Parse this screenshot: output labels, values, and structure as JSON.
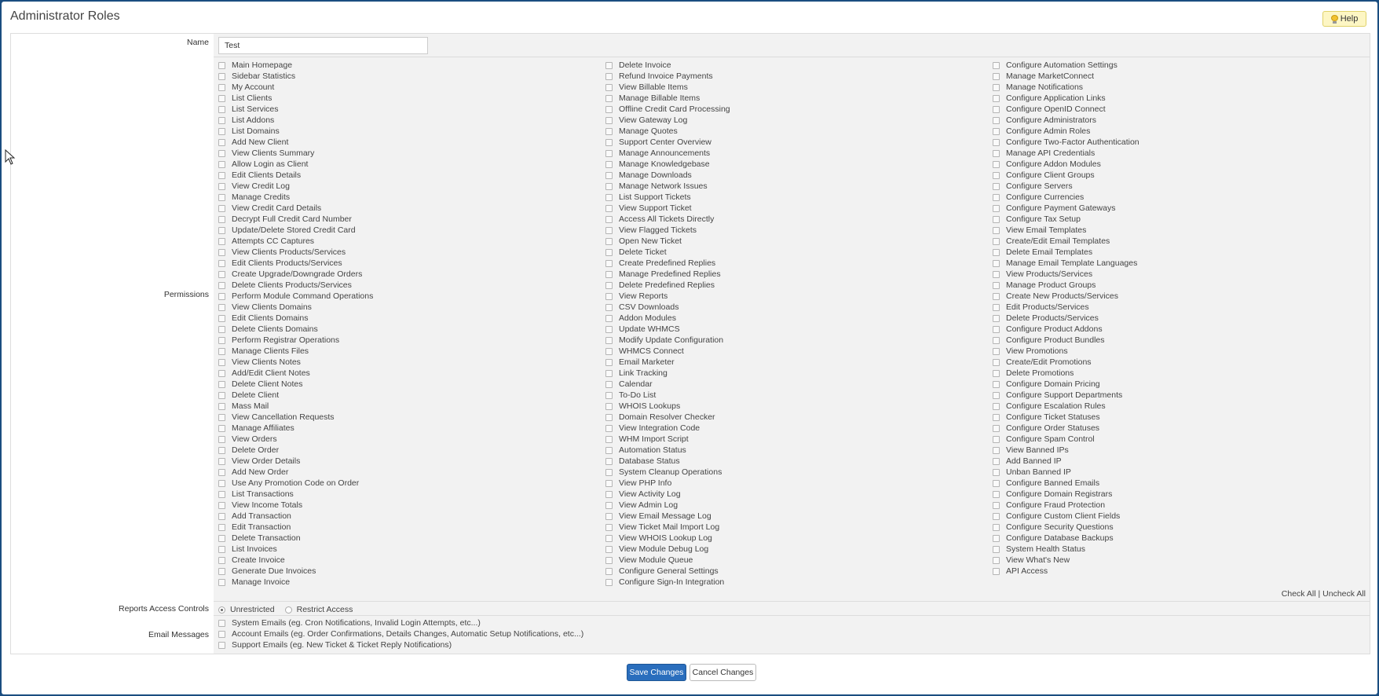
{
  "page": {
    "title": "Administrator Roles"
  },
  "help": {
    "label": "Help"
  },
  "form": {
    "name_label": "Name",
    "name_value": "Test",
    "permissions_label": "Permissions",
    "reports_label": "Reports Access Controls",
    "email_label": "Email Messages"
  },
  "permissions": {
    "col1": [
      "Main Homepage",
      "Sidebar Statistics",
      "My Account",
      "List Clients",
      "List Services",
      "List Addons",
      "List Domains",
      "Add New Client",
      "View Clients Summary",
      "Allow Login as Client",
      "Edit Clients Details",
      "View Credit Log",
      "Manage Credits",
      "View Credit Card Details",
      "Decrypt Full Credit Card Number",
      "Update/Delete Stored Credit Card",
      "Attempts CC Captures",
      "View Clients Products/Services",
      "Edit Clients Products/Services",
      "Create Upgrade/Downgrade Orders",
      "Delete Clients Products/Services",
      "Perform Module Command Operations",
      "View Clients Domains",
      "Edit Clients Domains",
      "Delete Clients Domains",
      "Perform Registrar Operations",
      "Manage Clients Files",
      "View Clients Notes",
      "Add/Edit Client Notes",
      "Delete Client Notes",
      "Delete Client",
      "Mass Mail",
      "View Cancellation Requests",
      "Manage Affiliates",
      "View Orders",
      "Delete Order",
      "View Order Details",
      "Add New Order",
      "Use Any Promotion Code on Order",
      "List Transactions",
      "View Income Totals",
      "Add Transaction",
      "Edit Transaction",
      "Delete Transaction",
      "List Invoices",
      "Create Invoice",
      "Generate Due Invoices",
      "Manage Invoice"
    ],
    "col2": [
      "Delete Invoice",
      "Refund Invoice Payments",
      "View Billable Items",
      "Manage Billable Items",
      "Offline Credit Card Processing",
      "View Gateway Log",
      "Manage Quotes",
      "Support Center Overview",
      "Manage Announcements",
      "Manage Knowledgebase",
      "Manage Downloads",
      "Manage Network Issues",
      "List Support Tickets",
      "View Support Ticket",
      "Access All Tickets Directly",
      "View Flagged Tickets",
      "Open New Ticket",
      "Delete Ticket",
      "Create Predefined Replies",
      "Manage Predefined Replies",
      "Delete Predefined Replies",
      "View Reports",
      "CSV Downloads",
      "Addon Modules",
      "Update WHMCS",
      "Modify Update Configuration",
      "WHMCS Connect",
      "Email Marketer",
      "Link Tracking",
      "Calendar",
      "To-Do List",
      "WHOIS Lookups",
      "Domain Resolver Checker",
      "View Integration Code",
      "WHM Import Script",
      "Automation Status",
      "Database Status",
      "System Cleanup Operations",
      "View PHP Info",
      "View Activity Log",
      "View Admin Log",
      "View Email Message Log",
      "View Ticket Mail Import Log",
      "View WHOIS Lookup Log",
      "View Module Debug Log",
      "View Module Queue",
      "Configure General Settings",
      "Configure Sign-In Integration"
    ],
    "col3": [
      "Configure Automation Settings",
      "Manage MarketConnect",
      "Manage Notifications",
      "Configure Application Links",
      "Configure OpenID Connect",
      "Configure Administrators",
      "Configure Admin Roles",
      "Configure Two-Factor Authentication",
      "Manage API Credentials",
      "Configure Addon Modules",
      "Configure Client Groups",
      "Configure Servers",
      "Configure Currencies",
      "Configure Payment Gateways",
      "Configure Tax Setup",
      "View Email Templates",
      "Create/Edit Email Templates",
      "Delete Email Templates",
      "Manage Email Template Languages",
      "View Products/Services",
      "Manage Product Groups",
      "Create New Products/Services",
      "Edit Products/Services",
      "Delete Products/Services",
      "Configure Product Addons",
      "Configure Product Bundles",
      "View Promotions",
      "Create/Edit Promotions",
      "Delete Promotions",
      "Configure Domain Pricing",
      "Configure Support Departments",
      "Configure Escalation Rules",
      "Configure Ticket Statuses",
      "Configure Order Statuses",
      "Configure Spam Control",
      "View Banned IPs",
      "Add Banned IP",
      "Unban Banned IP",
      "Configure Banned Emails",
      "Configure Domain Registrars",
      "Configure Fraud Protection",
      "Configure Custom Client Fields",
      "Configure Security Questions",
      "Configure Database Backups",
      "System Health Status",
      "View What's New",
      "API Access"
    ]
  },
  "check_links": {
    "check_all": "Check All",
    "separator": "|",
    "uncheck_all": "Uncheck All"
  },
  "reports": {
    "unrestricted": "Unrestricted",
    "restrict": "Restrict Access",
    "selected": "Unrestricted"
  },
  "emails": [
    "System Emails (eg. Cron Notifications, Invalid Login Attempts, etc...)",
    "Account Emails (eg. Order Confirmations, Details Changes, Automatic Setup Notifications, etc...)",
    "Support Emails (eg. New Ticket & Ticket Reply Notifications)"
  ],
  "buttons": {
    "save": "Save Changes",
    "cancel": "Cancel Changes"
  },
  "colors": {
    "primary": "#2a6ebd",
    "frame": "#1a4d80",
    "help_bg": "#fdf6c4"
  }
}
